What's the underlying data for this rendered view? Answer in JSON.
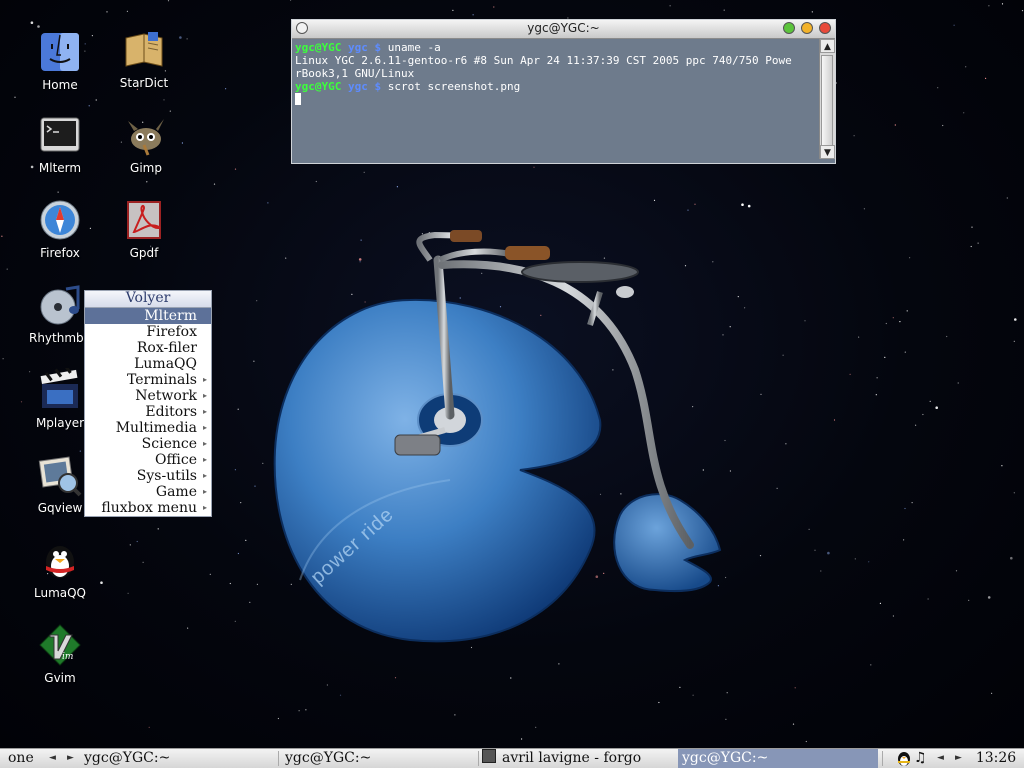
{
  "desktop": {
    "icons": [
      {
        "label": "Home",
        "icon": "finder-home-icon"
      },
      {
        "label": "StarDict",
        "icon": "book-icon"
      },
      {
        "label": "Mlterm",
        "icon": "terminal-icon"
      },
      {
        "label": "Gimp",
        "icon": "gimp-icon"
      },
      {
        "label": "Firefox",
        "icon": "compass-icon"
      },
      {
        "label": "Gpdf",
        "icon": "pdf-icon"
      },
      {
        "label": "Rhythmbo",
        "icon": "cd-music-icon"
      },
      {
        "label": "Mplayer",
        "icon": "clapperboard-icon"
      },
      {
        "label": "Gqview",
        "icon": "photo-viewer-icon"
      },
      {
        "label": "LumaQQ",
        "icon": "penguin-icon"
      },
      {
        "label": "Gvim",
        "icon": "vim-icon"
      }
    ],
    "wallpaper_text": "power ride"
  },
  "terminal": {
    "title": "ygc@YGC:~",
    "lines": [
      {
        "user": "ygc@YGC",
        "dir": "ygc",
        "sym": "$",
        "cmd": "uname -a"
      },
      {
        "out": "Linux YGC 2.6.11-gentoo-r6 #8 Sun Apr 24 11:37:39 CST 2005 ppc 740/750 Powe"
      },
      {
        "out": "rBook3,1 GNU/Linux"
      },
      {
        "user": "ygc@YGC",
        "dir": "ygc",
        "sym": "$",
        "cmd": "scrot screenshot.png"
      }
    ],
    "colors": {
      "background": "#6e7b8c",
      "prompt_user": "#3cff3c",
      "prompt_dir": "#5e8cff"
    }
  },
  "menu": {
    "title": "Volyer",
    "items": [
      {
        "label": "Mlterm",
        "selected": true,
        "submenu": false
      },
      {
        "label": "Firefox",
        "selected": false,
        "submenu": false
      },
      {
        "label": "Rox-filer",
        "selected": false,
        "submenu": false
      },
      {
        "label": "LumaQQ",
        "selected": false,
        "submenu": false
      },
      {
        "label": "Terminals",
        "selected": false,
        "submenu": true
      },
      {
        "label": "Network",
        "selected": false,
        "submenu": true
      },
      {
        "label": "Editors",
        "selected": false,
        "submenu": true
      },
      {
        "label": "Multimedia",
        "selected": false,
        "submenu": true
      },
      {
        "label": "Science",
        "selected": false,
        "submenu": true
      },
      {
        "label": "Office",
        "selected": false,
        "submenu": true
      },
      {
        "label": "Sys-utils",
        "selected": false,
        "submenu": true
      },
      {
        "label": "Game",
        "selected": false,
        "submenu": true
      },
      {
        "label": "fluxbox menu",
        "selected": false,
        "submenu": true
      }
    ]
  },
  "taskbar": {
    "workspace": "one",
    "tasks": [
      {
        "label": "ygc@YGC:~",
        "active": false
      },
      {
        "label": "ygc@YGC:~",
        "active": false
      },
      {
        "label": "avril lavigne - forgo",
        "active": false
      },
      {
        "label": "ygc@YGC:~",
        "active": true
      }
    ],
    "clock": "13:26",
    "tray_icons": [
      "qq-penguin-icon",
      "music-note-icon"
    ]
  }
}
